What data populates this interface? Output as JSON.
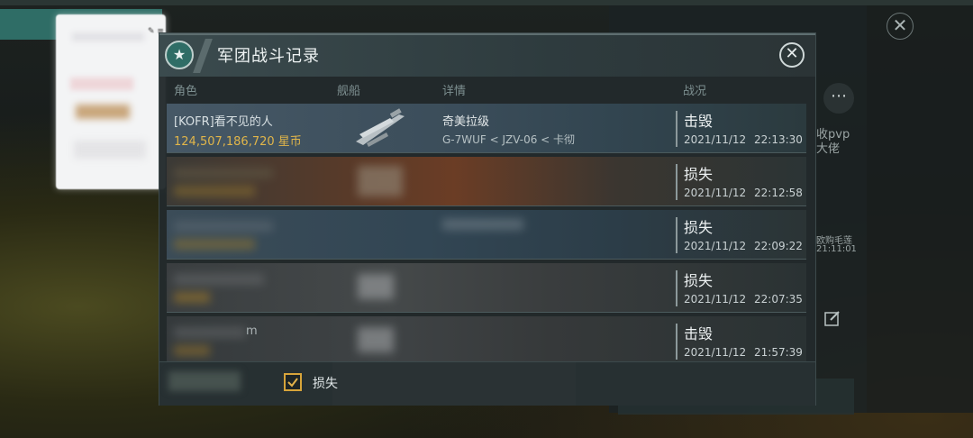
{
  "background": {
    "right_snippets": [
      "收pvp",
      "大佬",
      "欧购毛莲",
      "21:11:01"
    ]
  },
  "dialog": {
    "title": "军团战斗记录",
    "columns": {
      "role": "角色",
      "ship": "舰船",
      "detail": "详情",
      "status": "战况"
    },
    "records": [
      {
        "role_name": "[KOFR]看不见的人",
        "role_value": "124,507,186,720 星币",
        "detail_name": "奇美拉级",
        "detail_route": "G-7WUF < JZV-06 < 卡彻",
        "status": "击毁",
        "date": "2021/11/12",
        "time": "22:13:30",
        "blurred": false
      },
      {
        "role_name": "",
        "role_value": "",
        "detail_name": "",
        "detail_route": "",
        "status": "损失",
        "date": "2021/11/12",
        "time": "22:12:58",
        "blurred": true
      },
      {
        "role_name": "",
        "role_value": "",
        "detail_name": "",
        "detail_route": "",
        "status": "损失",
        "date": "2021/11/12",
        "time": "22:09:22",
        "blurred": true
      },
      {
        "role_name": "",
        "role_value": "",
        "detail_name": "",
        "detail_route": "",
        "status": "损失",
        "date": "2021/11/12",
        "time": "22:07:35",
        "blurred": true
      },
      {
        "role_name": "m",
        "role_value": "",
        "detail_name": "",
        "detail_route": "",
        "status": "击毁",
        "date": "2021/11/12",
        "time": "21:57:39",
        "blurred": true
      }
    ],
    "footer": {
      "filter_label": "损失",
      "filter_checked": true
    }
  },
  "colors": {
    "accent_teal": "#2f6d66",
    "gold": "#e0b54a",
    "checkbox_border": "#d7a43a"
  }
}
